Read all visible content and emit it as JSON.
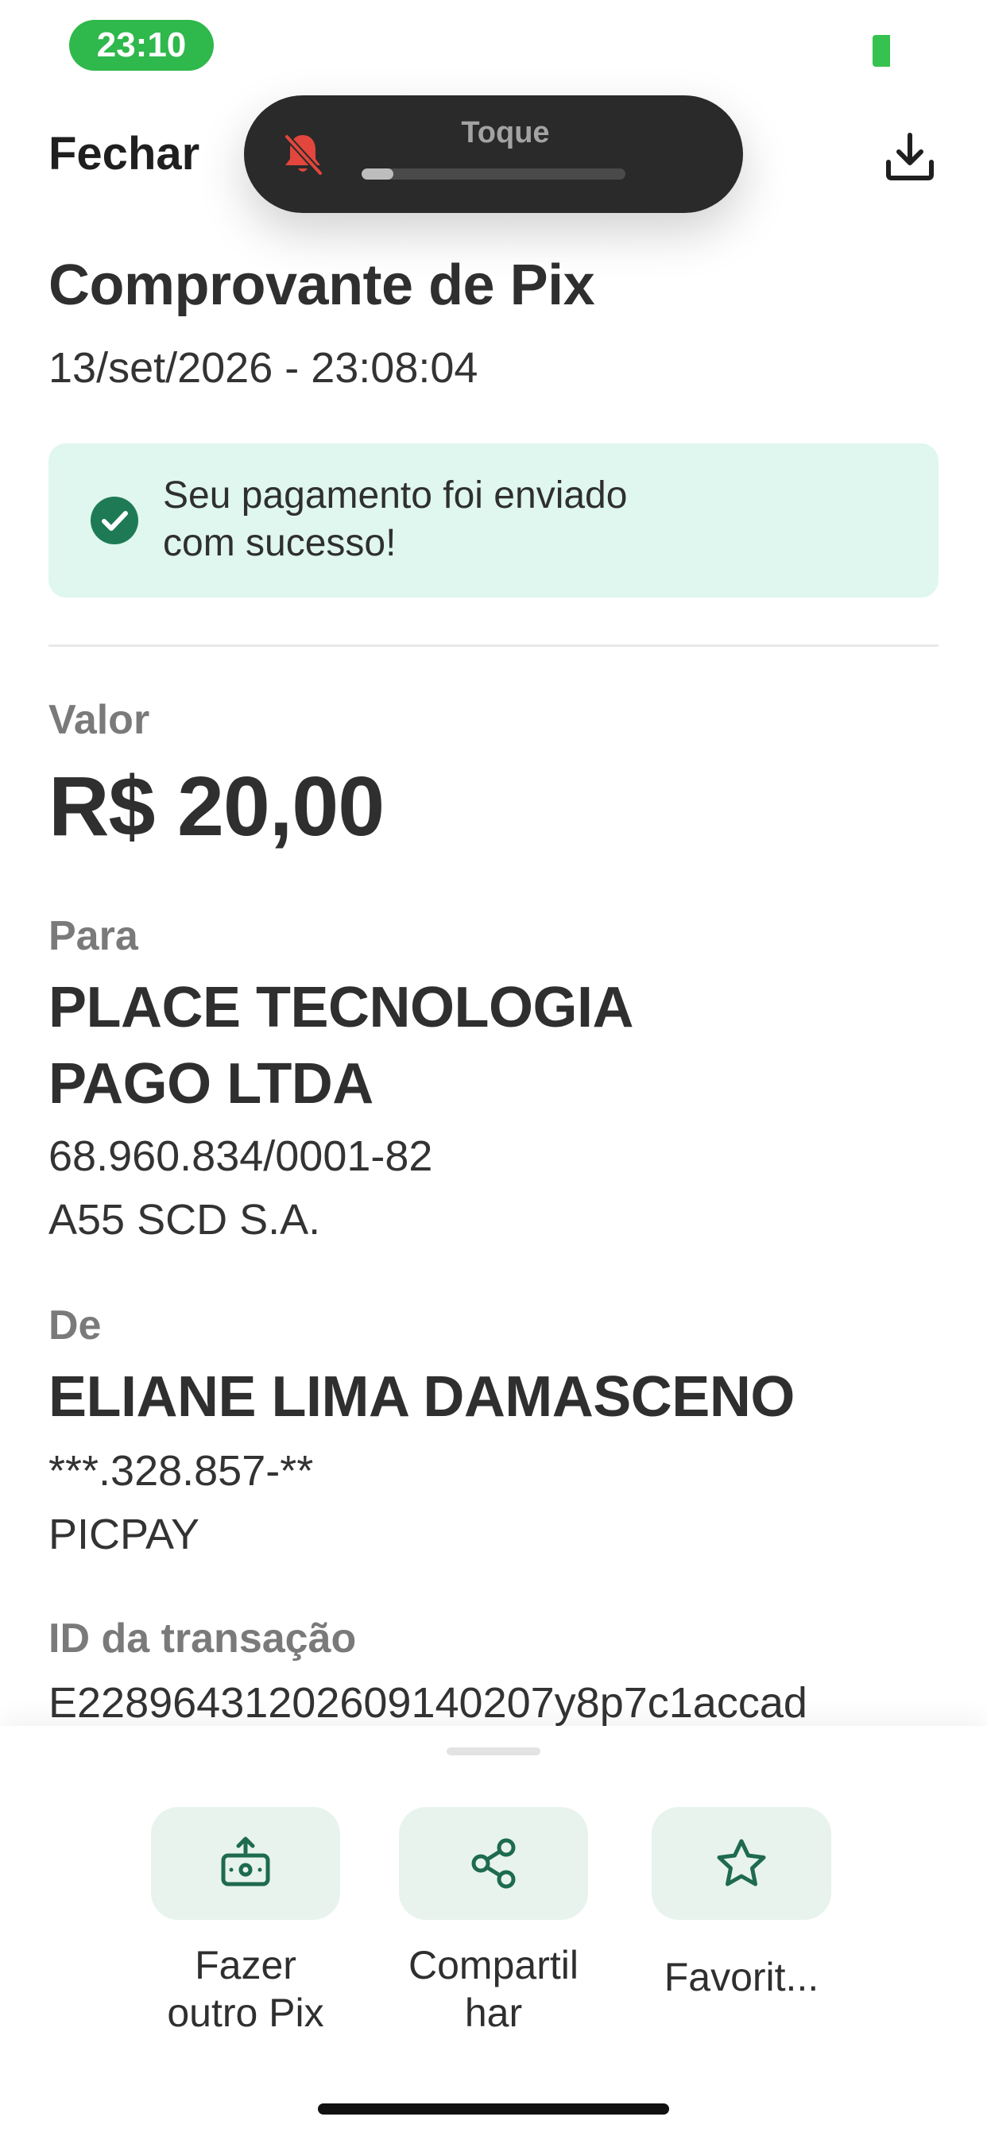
{
  "status_bar": {
    "time": "23:10",
    "battery_fragment": "3"
  },
  "header": {
    "close_label": "Fechar"
  },
  "ringer_toast": {
    "label": "Toque",
    "volume_level": 0.12
  },
  "receipt": {
    "title": "Comprovante de Pix",
    "datetime": "13/set/2026 - 23:08:04",
    "success_message_line1": "Seu pagamento foi enviado",
    "success_message_line2": "com sucesso!",
    "value_label": "Valor",
    "amount": "R$ 20,00",
    "to_label": "Para",
    "to_name_line1": "PLACE TECNOLOGIA",
    "to_name_line2": "PAGO LTDA",
    "to_document": "68.960.834/0001-82",
    "to_institution": "A55 SCD S.A.",
    "from_label": "De",
    "from_name": "ELIANE LIMA DAMASCENO",
    "from_document": "***.328.857-**",
    "from_institution": "PICPAY",
    "transaction_id_label": "ID da transação",
    "transaction_id": "E22896431202609140207y8p7c1accad"
  },
  "actions": [
    {
      "line1": "Fazer",
      "line2": "outro Pix",
      "icon": "send-money-icon"
    },
    {
      "line1": "Compartil",
      "line2": "har",
      "icon": "share-icon"
    },
    {
      "line1": "Favorit...",
      "line2": "",
      "icon": "star-icon"
    }
  ],
  "colors": {
    "success_bg": "#dff7ee",
    "success_icon": "#1e7a55",
    "action_bg": "#e8f3ee",
    "action_icon": "#1e6b4f",
    "status_pill": "#2fb84b"
  }
}
